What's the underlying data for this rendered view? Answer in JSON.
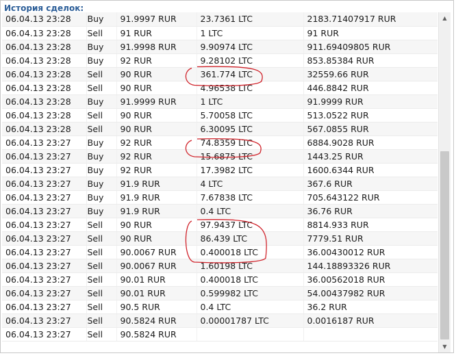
{
  "title": "История сделок:",
  "annotation_color": "#d0222a",
  "trades": [
    {
      "date": "06.04.13 23:28",
      "type": "Buy",
      "price": "91.9997 RUR",
      "amount": "23.7361 LTC",
      "total": "2183.71407917 RUR"
    },
    {
      "date": "06.04.13 23:28",
      "type": "Sell",
      "price": "91 RUR",
      "amount": "1 LTC",
      "total": "91 RUR"
    },
    {
      "date": "06.04.13 23:28",
      "type": "Buy",
      "price": "91.9998 RUR",
      "amount": "9.90974 LTC",
      "total": "911.69409805 RUR"
    },
    {
      "date": "06.04.13 23:28",
      "type": "Buy",
      "price": "92 RUR",
      "amount": "9.28102 LTC",
      "total": "853.85384 RUR"
    },
    {
      "date": "06.04.13 23:28",
      "type": "Sell",
      "price": "90 RUR",
      "amount": "361.774 LTC",
      "total": "32559.66 RUR"
    },
    {
      "date": "06.04.13 23:28",
      "type": "Sell",
      "price": "90 RUR",
      "amount": "4.96538 LTC",
      "total": "446.8842 RUR"
    },
    {
      "date": "06.04.13 23:28",
      "type": "Buy",
      "price": "91.9999 RUR",
      "amount": "1 LTC",
      "total": "91.9999 RUR"
    },
    {
      "date": "06.04.13 23:28",
      "type": "Sell",
      "price": "90 RUR",
      "amount": "5.70058 LTC",
      "total": "513.0522 RUR"
    },
    {
      "date": "06.04.13 23:28",
      "type": "Sell",
      "price": "90 RUR",
      "amount": "6.30095 LTC",
      "total": "567.0855 RUR"
    },
    {
      "date": "06.04.13 23:27",
      "type": "Buy",
      "price": "92 RUR",
      "amount": "74.8359 LTC",
      "total": "6884.9028 RUR"
    },
    {
      "date": "06.04.13 23:27",
      "type": "Buy",
      "price": "92 RUR",
      "amount": "15.6875 LTC",
      "total": "1443.25 RUR"
    },
    {
      "date": "06.04.13 23:27",
      "type": "Buy",
      "price": "92 RUR",
      "amount": "17.3982 LTC",
      "total": "1600.6344 RUR"
    },
    {
      "date": "06.04.13 23:27",
      "type": "Buy",
      "price": "91.9 RUR",
      "amount": "4 LTC",
      "total": "367.6 RUR"
    },
    {
      "date": "06.04.13 23:27",
      "type": "Buy",
      "price": "91.9 RUR",
      "amount": "7.67838 LTC",
      "total": "705.643122 RUR"
    },
    {
      "date": "06.04.13 23:27",
      "type": "Buy",
      "price": "91.9 RUR",
      "amount": "0.4 LTC",
      "total": "36.76 RUR"
    },
    {
      "date": "06.04.13 23:27",
      "type": "Sell",
      "price": "90 RUR",
      "amount": "97.9437 LTC",
      "total": "8814.933 RUR"
    },
    {
      "date": "06.04.13 23:27",
      "type": "Sell",
      "price": "90 RUR",
      "amount": "86.439 LTC",
      "total": "7779.51 RUR"
    },
    {
      "date": "06.04.13 23:27",
      "type": "Sell",
      "price": "90.0067 RUR",
      "amount": "0.400018 LTC",
      "total": "36.00430012 RUR"
    },
    {
      "date": "06.04.13 23:27",
      "type": "Sell",
      "price": "90.0067 RUR",
      "amount": "1.60198 LTC",
      "total": "144.18893326 RUR"
    },
    {
      "date": "06.04.13 23:27",
      "type": "Sell",
      "price": "90.01 RUR",
      "amount": "0.400018 LTC",
      "total": "36.00562018 RUR"
    },
    {
      "date": "06.04.13 23:27",
      "type": "Sell",
      "price": "90.01 RUR",
      "amount": "0.599982 LTC",
      "total": "54.00437982 RUR"
    },
    {
      "date": "06.04.13 23:27",
      "type": "Sell",
      "price": "90.5 RUR",
      "amount": "0.4 LTC",
      "total": "36.2 RUR"
    },
    {
      "date": "06.04.13 23:27",
      "type": "Sell",
      "price": "90.5824 RUR",
      "amount": "0.00001787 LTC",
      "total": "0.0016187 RUR"
    },
    {
      "date": "06.04.13 23:27",
      "type": "Sell",
      "price": "90.5824 RUR",
      "amount": "",
      "total": ""
    }
  ],
  "circled_rows": [
    4,
    9,
    15,
    16
  ]
}
